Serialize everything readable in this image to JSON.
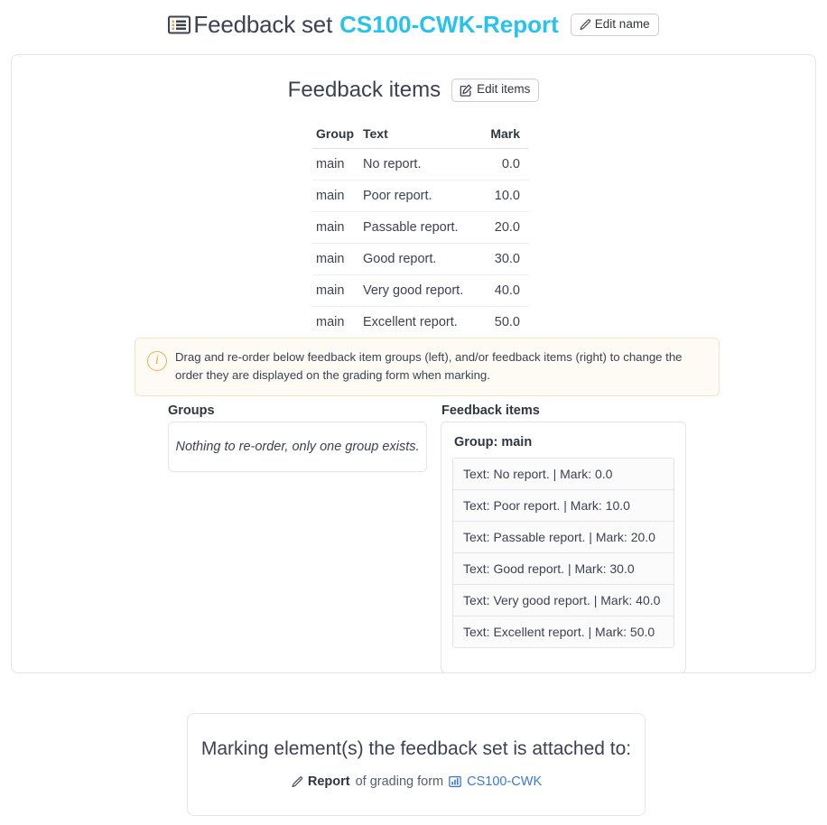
{
  "header": {
    "list_icon": "list-icon",
    "title_prefix": "Feedback set",
    "set_name": "CS100-CWK-Report",
    "edit_name_button": "Edit name",
    "edit_name_icon": "pen-icon",
    "accent_color": "#28c3ec"
  },
  "feedback_items_section": {
    "title": "Feedback items",
    "edit_items_button": "Edit items",
    "edit_items_icon": "edit-square-icon",
    "table": {
      "columns": [
        "Group",
        "Text",
        "Mark"
      ],
      "rows": [
        {
          "group": "main",
          "text": "No report.",
          "mark": "0.0"
        },
        {
          "group": "main",
          "text": "Poor report.",
          "mark": "10.0"
        },
        {
          "group": "main",
          "text": "Passable report.",
          "mark": "20.0"
        },
        {
          "group": "main",
          "text": "Good report.",
          "mark": "30.0"
        },
        {
          "group": "main",
          "text": "Very good report.",
          "mark": "40.0"
        },
        {
          "group": "main",
          "text": "Excellent report.",
          "mark": "50.0"
        }
      ]
    }
  },
  "alert": {
    "icon": "info-circle-icon",
    "text": "Drag and re-order below feedback item groups (left), and/or feedback items (right) to change the order they are displayed on the grading form when marking.",
    "border_color": "#f5e3c4",
    "background_color": "#fefbf4",
    "icon_color": "#f0ad4e"
  },
  "reorder": {
    "groups": {
      "label": "Groups",
      "empty_message": "Nothing to re-order, only one group exists."
    },
    "items": {
      "label": "Feedback items",
      "group_heading": "Group: main",
      "entries": [
        "Text: No report. | Mark: 0.0",
        "Text: Poor report. | Mark: 10.0",
        "Text: Passable report. | Mark: 20.0",
        "Text: Good report. | Mark: 30.0",
        "Text: Very good report. | Mark: 40.0",
        "Text: Excellent report. | Mark: 50.0"
      ]
    }
  },
  "attached": {
    "title": "Marking element(s) the feedback set is attached to:",
    "element_icon": "pen-icon",
    "element_name": "Report",
    "connector": "of grading form",
    "form_icon": "bar-chart-icon",
    "form_name": "CS100-CWK",
    "link_color": "#3a7ad4"
  }
}
